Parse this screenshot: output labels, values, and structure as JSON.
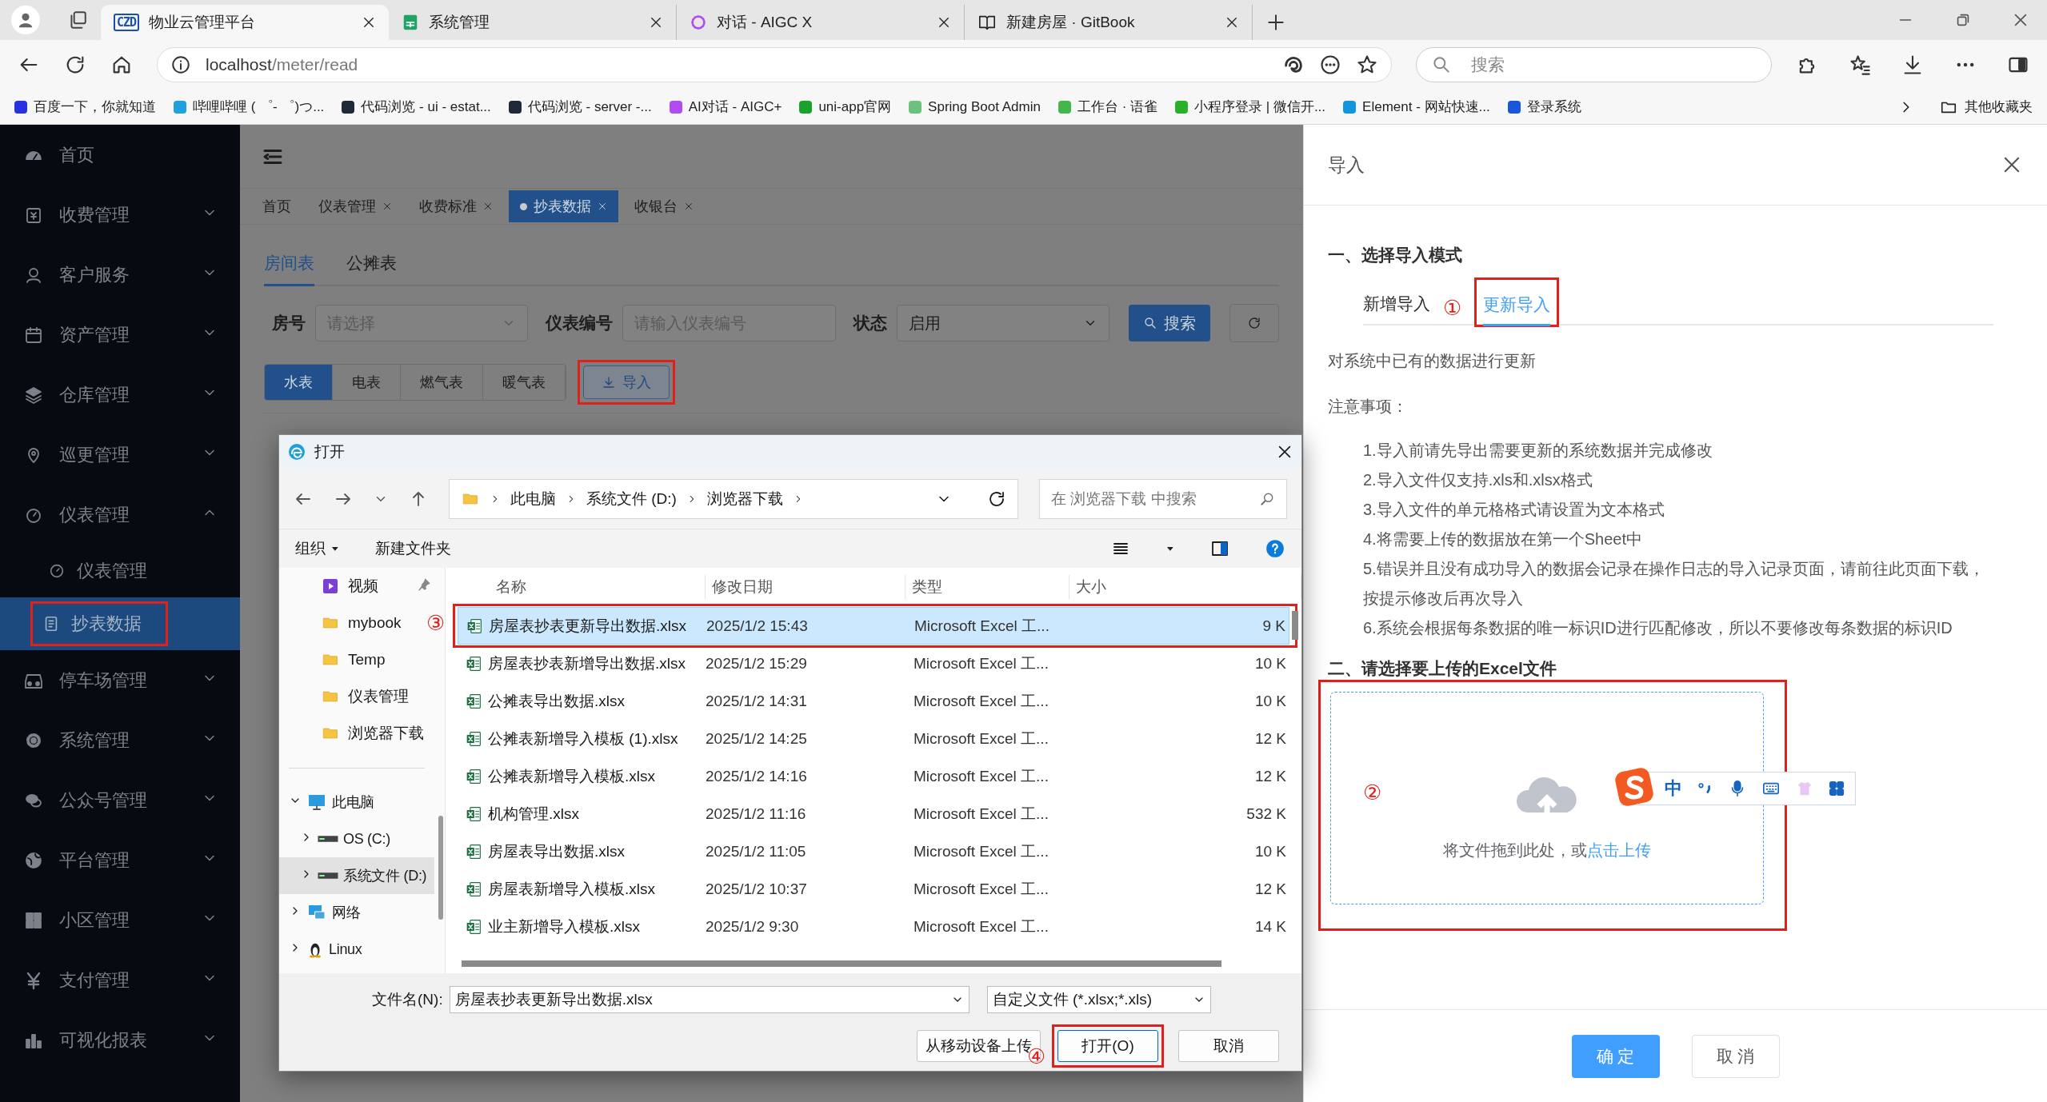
{
  "browser": {
    "tabs": [
      {
        "title": "物业云管理平台",
        "logo": "CZD",
        "selected": true
      },
      {
        "title": "系统管理",
        "selected": false
      },
      {
        "title": "对话 - AIGC X",
        "selected": false
      },
      {
        "title": "新建房屋 · GitBook",
        "selected": false
      }
    ],
    "address": {
      "host": "localhost",
      "path": "/meter/read"
    },
    "search": {
      "placeholder": "搜索"
    },
    "bookmarks": [
      "百度一下，你就知道",
      "哔哩哔哩 ( ゜- ゜)つ...",
      "代码浏览 - ui - estat...",
      "代码浏览 - server -...",
      "AI对话 - AIGC+",
      "uni-app官网",
      "Spring Boot Admin",
      "工作台 · 语雀",
      "小程序登录 | 微信开...",
      "Element - 网站快速...",
      "登录系统"
    ],
    "other_bookmarks": "其他收藏夹"
  },
  "sidebar": {
    "items": [
      {
        "label": "首页",
        "kind": "link",
        "selected": false
      },
      {
        "label": "收费管理",
        "kind": "menu",
        "expanded": false,
        "selected": false
      },
      {
        "label": "客户服务",
        "kind": "menu",
        "expanded": false,
        "selected": false
      },
      {
        "label": "资产管理",
        "kind": "menu",
        "expanded": false,
        "selected": false
      },
      {
        "label": "仓库管理",
        "kind": "menu",
        "expanded": false,
        "selected": false
      },
      {
        "label": "巡更管理",
        "kind": "menu",
        "expanded": false,
        "selected": false
      },
      {
        "label": "仪表管理",
        "kind": "menu",
        "expanded": true,
        "selected": false,
        "children": [
          {
            "label": "仪表管理",
            "selected": false
          },
          {
            "label": "抄表数据",
            "selected": true,
            "highlighted": true
          }
        ]
      },
      {
        "label": "停车场管理",
        "kind": "menu",
        "expanded": false,
        "selected": false
      },
      {
        "label": "系统管理",
        "kind": "menu",
        "expanded": false,
        "selected": false
      },
      {
        "label": "公众号管理",
        "kind": "menu",
        "expanded": false,
        "selected": false
      },
      {
        "label": "平台管理",
        "kind": "menu",
        "expanded": false,
        "selected": false
      },
      {
        "label": "小区管理",
        "kind": "menu",
        "expanded": false,
        "selected": false
      },
      {
        "label": "支付管理",
        "kind": "menu",
        "expanded": false,
        "selected": false
      },
      {
        "label": "可视化报表",
        "kind": "menu",
        "expanded": false,
        "selected": false
      }
    ]
  },
  "page_tabs": [
    {
      "label": "首页",
      "closable": false,
      "selected": false
    },
    {
      "label": "仪表管理",
      "closable": true,
      "selected": false
    },
    {
      "label": "收费标准",
      "closable": true,
      "selected": false
    },
    {
      "label": "抄表数据",
      "closable": true,
      "selected": true
    },
    {
      "label": "收银台",
      "closable": true,
      "selected": false
    }
  ],
  "sub_tabs": [
    {
      "label": "房间表",
      "selected": true
    },
    {
      "label": "公摊表",
      "selected": false
    }
  ],
  "filters": [
    {
      "label": "房号",
      "kind": "select",
      "placeholder": "请选择"
    },
    {
      "label": "仪表编号",
      "kind": "input",
      "placeholder": "请输入仪表编号"
    },
    {
      "label": "状态",
      "kind": "select",
      "value": "启用"
    }
  ],
  "search_button": "搜索",
  "meter_types": [
    {
      "label": "水表",
      "selected": true
    },
    {
      "label": "电表",
      "selected": false
    },
    {
      "label": "燃气表",
      "selected": false
    },
    {
      "label": "暖气表",
      "selected": false
    }
  ],
  "import_button": {
    "label": "导入",
    "highlighted": true
  },
  "file_dialog": {
    "title": "打开",
    "breadcrumb": [
      "此电脑",
      "系统文件 (D:)",
      "浏览器下载"
    ],
    "search": {
      "placeholder": "在 浏览器下载 中搜索"
    },
    "organize": "组织",
    "new_folder": "新建文件夹",
    "nav": [
      {
        "label": "视频",
        "kind": "video",
        "pinned": true,
        "selected": false
      },
      {
        "label": "mybook",
        "kind": "folder",
        "pinned": false,
        "selected": false
      },
      {
        "label": "Temp",
        "kind": "folder",
        "pinned": false,
        "selected": false
      },
      {
        "label": "仪表管理",
        "kind": "folder",
        "pinned": false,
        "selected": false
      },
      {
        "label": "浏览器下载",
        "kind": "folder",
        "pinned": false,
        "selected": false
      }
    ],
    "tree": [
      {
        "label": "此电脑",
        "kind": "pc",
        "expanded": true,
        "selected": false,
        "children": [
          {
            "label": "OS (C:)",
            "kind": "drive",
            "expanded": false,
            "selected": false
          },
          {
            "label": "系统文件 (D:)",
            "kind": "drive",
            "expanded": false,
            "selected": true
          }
        ]
      },
      {
        "label": "网络",
        "kind": "network",
        "expanded": false,
        "selected": false
      },
      {
        "label": "Linux",
        "kind": "linux",
        "expanded": false,
        "selected": false
      }
    ],
    "columns": [
      "名称",
      "修改日期",
      "类型",
      "大小"
    ],
    "files": [
      {
        "name": "房屋表抄表更新导出数据.xlsx",
        "date": "2025/1/2 15:43",
        "type": "Microsoft Excel 工...",
        "size": "9 K",
        "selected": true,
        "highlighted": true,
        "annotation": "③"
      },
      {
        "name": "房屋表抄表新增导出数据.xlsx",
        "date": "2025/1/2 15:29",
        "type": "Microsoft Excel 工...",
        "size": "10 K",
        "selected": false
      },
      {
        "name": "公摊表导出数据.xlsx",
        "date": "2025/1/2 14:31",
        "type": "Microsoft Excel 工...",
        "size": "10 K",
        "selected": false
      },
      {
        "name": "公摊表新增导入模板 (1).xlsx",
        "date": "2025/1/2 14:25",
        "type": "Microsoft Excel 工...",
        "size": "12 K",
        "selected": false
      },
      {
        "name": "公摊表新增导入模板.xlsx",
        "date": "2025/1/2 14:16",
        "type": "Microsoft Excel 工...",
        "size": "12 K",
        "selected": false
      },
      {
        "name": "机构管理.xlsx",
        "date": "2025/1/2 11:16",
        "type": "Microsoft Excel 工...",
        "size": "532 K",
        "selected": false
      },
      {
        "name": "房屋表导出数据.xlsx",
        "date": "2025/1/2 11:05",
        "type": "Microsoft Excel 工...",
        "size": "10 K",
        "selected": false
      },
      {
        "name": "房屋表新增导入模板.xlsx",
        "date": "2025/1/2 10:37",
        "type": "Microsoft Excel 工...",
        "size": "12 K",
        "selected": false
      },
      {
        "name": "业主新增导入模板.xlsx",
        "date": "2025/1/2 9:30",
        "type": "Microsoft Excel 工...",
        "size": "14 K",
        "selected": false
      }
    ],
    "filename": {
      "label": "文件名(N):",
      "value": "房屋表抄表更新导出数据.xlsx"
    },
    "filter": "自定义文件 (*.xlsx;*.xls)",
    "upload_button": "从移动设备上传",
    "open_button": {
      "label": "打开(O)",
      "highlighted": true,
      "annotation": "④"
    },
    "cancel_button": "取消"
  },
  "import_drawer": {
    "title": "导入",
    "section_1": "一、选择导入模式",
    "modes": [
      {
        "label": "新增导入",
        "selected": false
      },
      {
        "label": "更新导入",
        "selected": true,
        "highlighted": true
      }
    ],
    "mode_annotation": "①",
    "description": "对系统中已有的数据进行更新",
    "notes_title": "注意事项：",
    "notes": [
      "1.导入前请先导出需要更新的系统数据并完成修改",
      "2.导入文件仅支持.xls和.xlsx格式",
      "3.导入文件的单元格格式请设置为文本格式",
      "4.将需要上传的数据放在第一个Sheet中",
      "5.错误并且没有成功导入的数据会记录在操作日志的导入记录页面，请前往此页面下载，按提示修改后再次导入",
      "6.系统会根据每条数据的唯一标识ID进行匹配修改，所以不要修改每条数据的标识ID"
    ],
    "section_2": "二、请选择要上传的Excel文件",
    "upload": {
      "text": "将文件拖到此处，或",
      "link": "点击上传",
      "highlighted": true,
      "annotation": "②"
    },
    "confirm": "确 定",
    "cancel": "取 消"
  },
  "ime_toolbar": {
    "mode": "中"
  }
}
